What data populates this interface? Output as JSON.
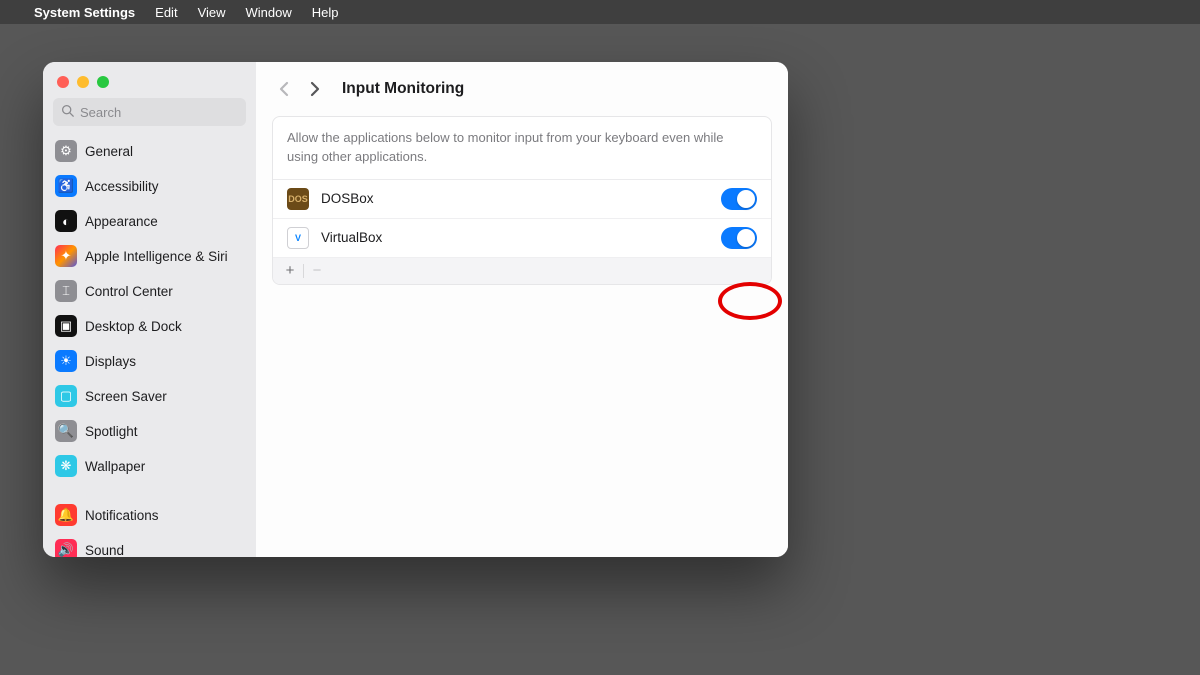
{
  "menubar": {
    "appname": "System Settings",
    "items": [
      "Edit",
      "View",
      "Window",
      "Help"
    ]
  },
  "search": {
    "placeholder": "Search"
  },
  "sidebar": {
    "items": [
      {
        "id": "general",
        "label": "General",
        "iconClass": "ic-general",
        "glyph": "⚙"
      },
      {
        "id": "accessibility",
        "label": "Accessibility",
        "iconClass": "ic-access",
        "glyph": "♿"
      },
      {
        "id": "appearance",
        "label": "Appearance",
        "iconClass": "ic-appear",
        "glyph": "◐"
      },
      {
        "id": "apple-intelligence-siri",
        "label": "Apple Intelligence & Siri",
        "iconClass": "ic-ai",
        "glyph": "✦"
      },
      {
        "id": "control-center",
        "label": "Control Center",
        "iconClass": "ic-cc",
        "glyph": "⌶"
      },
      {
        "id": "desktop-dock",
        "label": "Desktop & Dock",
        "iconClass": "ic-dock",
        "glyph": "▣"
      },
      {
        "id": "displays",
        "label": "Displays",
        "iconClass": "ic-disp",
        "glyph": "☀"
      },
      {
        "id": "screen-saver",
        "label": "Screen Saver",
        "iconClass": "ic-ss",
        "glyph": "▢"
      },
      {
        "id": "spotlight",
        "label": "Spotlight",
        "iconClass": "ic-spot",
        "glyph": "🔍"
      },
      {
        "id": "wallpaper",
        "label": "Wallpaper",
        "iconClass": "ic-wall",
        "glyph": "❋"
      },
      {
        "gap": true
      },
      {
        "id": "notifications",
        "label": "Notifications",
        "iconClass": "ic-notif",
        "glyph": "🔔"
      },
      {
        "id": "sound",
        "label": "Sound",
        "iconClass": "ic-sound",
        "glyph": "🔊"
      }
    ]
  },
  "page": {
    "title": "Input Monitoring",
    "description": "Allow the applications below to monitor input from your keyboard even while using other applications.",
    "apps": [
      {
        "id": "dosbox",
        "name": "DOSBox",
        "enabled": true,
        "iconBg": "#6b4a17",
        "iconText": "DOS"
      },
      {
        "id": "virtualbox",
        "name": "VirtualBox",
        "enabled": true,
        "iconBg": "#ffffff",
        "iconText": "V",
        "iconColor": "#0a84ff"
      }
    ],
    "footer": {
      "add": "+",
      "remove": "−"
    }
  }
}
